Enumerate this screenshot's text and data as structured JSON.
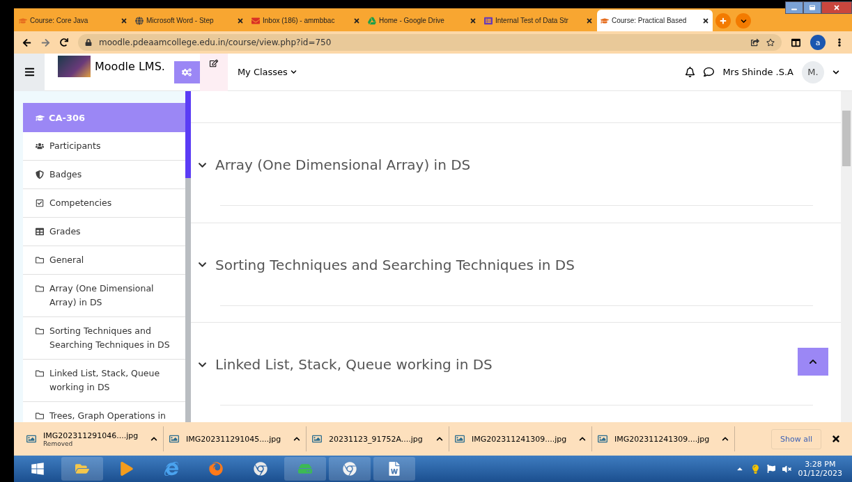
{
  "browser": {
    "tabs": [
      {
        "title": "Course: Core Java",
        "selected": false
      },
      {
        "title": "Microsoft Word - Step",
        "selected": false
      },
      {
        "title": "Inbox (186) - ammbbac",
        "selected": false
      },
      {
        "title": "Home - Google Drive",
        "selected": false
      },
      {
        "title": "Internal Test of Data Str",
        "selected": false
      },
      {
        "title": "Course: Practical Based",
        "selected": true
      }
    ],
    "url": "moodle.pdeaamcollege.edu.in/course/view.php?id=750",
    "profile": "a"
  },
  "header": {
    "site_name": "Moodle LMS.",
    "menu": "My Classes",
    "user_name": "Mrs Shinde .S.A",
    "avatar": "M."
  },
  "sidebar": {
    "course": "CA-306",
    "items": [
      {
        "label": "Participants"
      },
      {
        "label": "Badges"
      },
      {
        "label": "Competencies"
      },
      {
        "label": "Grades"
      },
      {
        "label": "General"
      },
      {
        "label": "Array (One Dimensional Array) in DS"
      },
      {
        "label": "Sorting Techniques and Searching Techniques in DS"
      },
      {
        "label": "Linked List, Stack, Queue working in DS"
      },
      {
        "label": "Trees, Graph Operations in"
      }
    ]
  },
  "sections": [
    {
      "title": "Array (One Dimensional Array) in DS",
      "expanded": true
    },
    {
      "title": "Sorting Techniques and Searching Techniques in DS",
      "expanded": true
    },
    {
      "title": "Linked List, Stack, Queue working in DS",
      "expanded": true
    }
  ],
  "downloads": {
    "items": [
      {
        "file": "IMG202311291046....jpg",
        "status": "Removed"
      },
      {
        "file": "IMG202311291045....jpg"
      },
      {
        "file": "20231123_91752A....jpg"
      },
      {
        "file": "IMG202311241309....jpg"
      },
      {
        "file": "IMG202311241309....jpg"
      }
    ],
    "show_all": "Show all"
  },
  "taskbar": {
    "time": "3:28 PM",
    "date": "01/12/2023"
  }
}
